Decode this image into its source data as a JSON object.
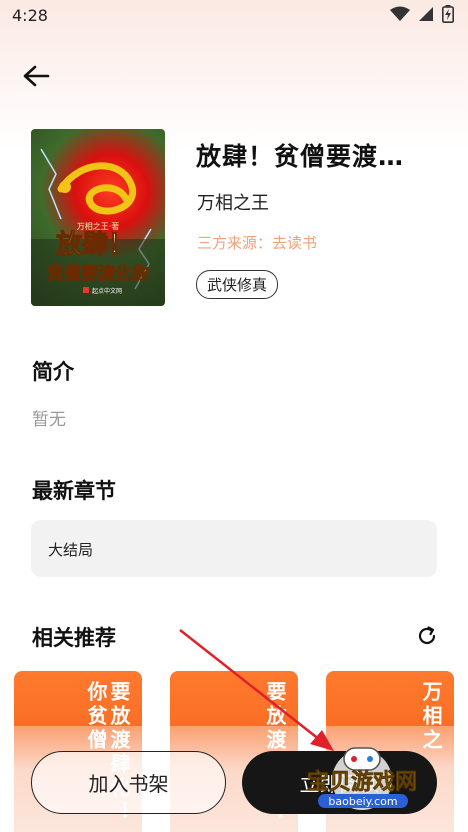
{
  "status_bar": {
    "time": "4:28"
  },
  "book": {
    "title": "放肆！贫僧要渡…",
    "author": "万相之王",
    "source": "三方来源：去读书",
    "tag": "武侠修真",
    "cover": {
      "title_line1": "放肆！",
      "title_line2": "贫僧要渡化你",
      "top_text": "万相之王·著",
      "publisher": "起点中文网"
    }
  },
  "intro": {
    "heading": "简介",
    "text": "暂无"
  },
  "latest_chapter": {
    "heading": "最新章节",
    "text": "大结局"
  },
  "recommendations": {
    "heading": "相关推荐",
    "items": [
      {
        "text": "要放渡肆化！你贫僧"
      },
      {
        "text": "要放渡肆化！"
      },
      {
        "text": "万相之"
      }
    ]
  },
  "actions": {
    "add_to_shelf": "加入书架",
    "start_reading": "立即阅读"
  },
  "watermark": {
    "name": "宝贝游戏网",
    "domain": "baobeiy.com"
  },
  "colors": {
    "accent": "#f0a27b",
    "primary_button": "#161616",
    "card_orange": "#f4641e",
    "arrow": "#e0202a"
  }
}
